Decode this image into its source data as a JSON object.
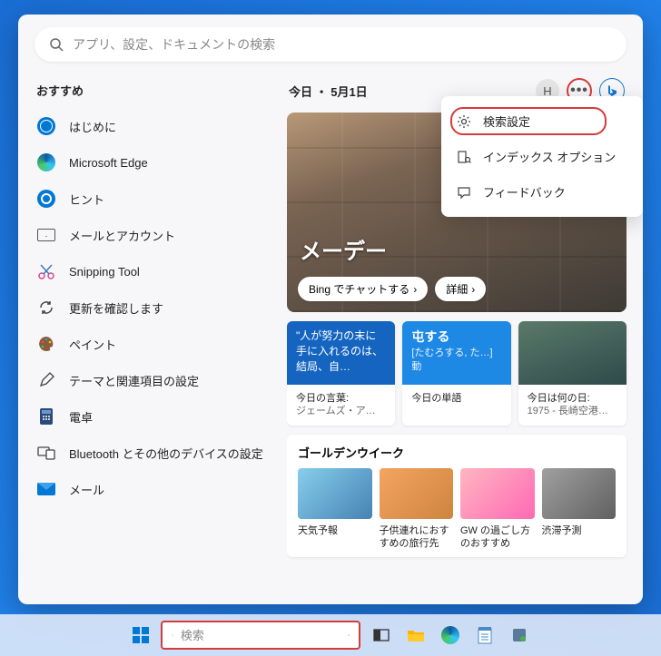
{
  "search": {
    "placeholder": "アプリ、設定、ドキュメントの検索"
  },
  "sidebar": {
    "title": "おすすめ",
    "items": [
      {
        "label": "はじめに"
      },
      {
        "label": "Microsoft Edge"
      },
      {
        "label": "ヒント"
      },
      {
        "label": "メールとアカウント"
      },
      {
        "label": "Snipping Tool"
      },
      {
        "label": "更新を確認します"
      },
      {
        "label": "ペイント"
      },
      {
        "label": "テーマと関連項目の設定"
      },
      {
        "label": "電卓"
      },
      {
        "label": "Bluetooth とその他のデバイスの設定"
      },
      {
        "label": "メール"
      }
    ]
  },
  "righthead": {
    "title": "今日 ・ 5月1日",
    "avatar_letter": "H"
  },
  "menu": {
    "items": [
      {
        "label": "検索設定"
      },
      {
        "label": "インデックス オプション"
      },
      {
        "label": "フィードバック"
      }
    ]
  },
  "hero": {
    "title": "メーデー",
    "btn_chat": "Bing でチャットする",
    "btn_detail": "詳細"
  },
  "cards": [
    {
      "top": "\"人が努力の末に手に入れるのは、結局、自…",
      "bot_title": "今日の言葉:",
      "bot_sub": "ジェームズ・ア…"
    },
    {
      "top": "屯する",
      "top_sub": "[たむろする, た…] 動",
      "bot_title": "今日の単語",
      "bot_sub": ""
    },
    {
      "top": "",
      "bot_title": "今日は何の日:",
      "bot_sub": "1975 - 長崎空港…"
    }
  ],
  "section": {
    "title": "ゴールデンウイーク",
    "tiles": [
      {
        "label": "天気予報"
      },
      {
        "label": "子供連れにおすすめの旅行先"
      },
      {
        "label": "GW の過ごし方のおすすめ"
      },
      {
        "label": "渋滞予測"
      }
    ]
  },
  "taskbar": {
    "search_placeholder": "検索"
  }
}
